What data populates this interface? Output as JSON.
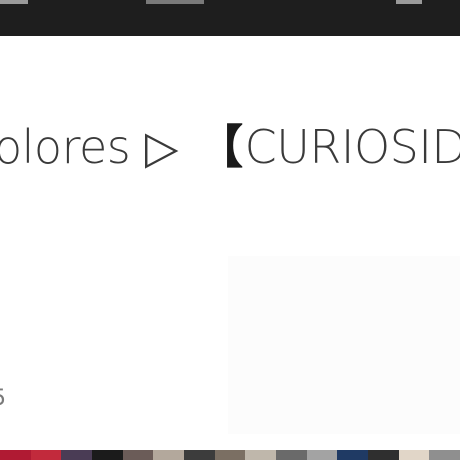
{
  "page": {
    "title_fragment_start": "olores",
    "title_separator": "▷",
    "title_bracket": "【",
    "title_fragment_end": "CURIOSID",
    "side_count": "5",
    "faded_snippet": ""
  },
  "colors": {
    "top_bar": "#1e1e1e",
    "text": "#3a3a3a",
    "background": "#ffffff",
    "bottom_strip": [
      "#b01a33",
      "#c22a3c",
      "#4a3c55",
      "#1b1b1b",
      "#6b5c58",
      "#b3a89c",
      "#3c3c3c",
      "#7b6f63",
      "#bfb7ab",
      "#6a6a6a",
      "#a3a3a3",
      "#1f3a64",
      "#2f2f2f",
      "#e1d6c8",
      "#8f8f8f"
    ]
  },
  "icons": {
    "separator": "triangle-right-icon"
  }
}
